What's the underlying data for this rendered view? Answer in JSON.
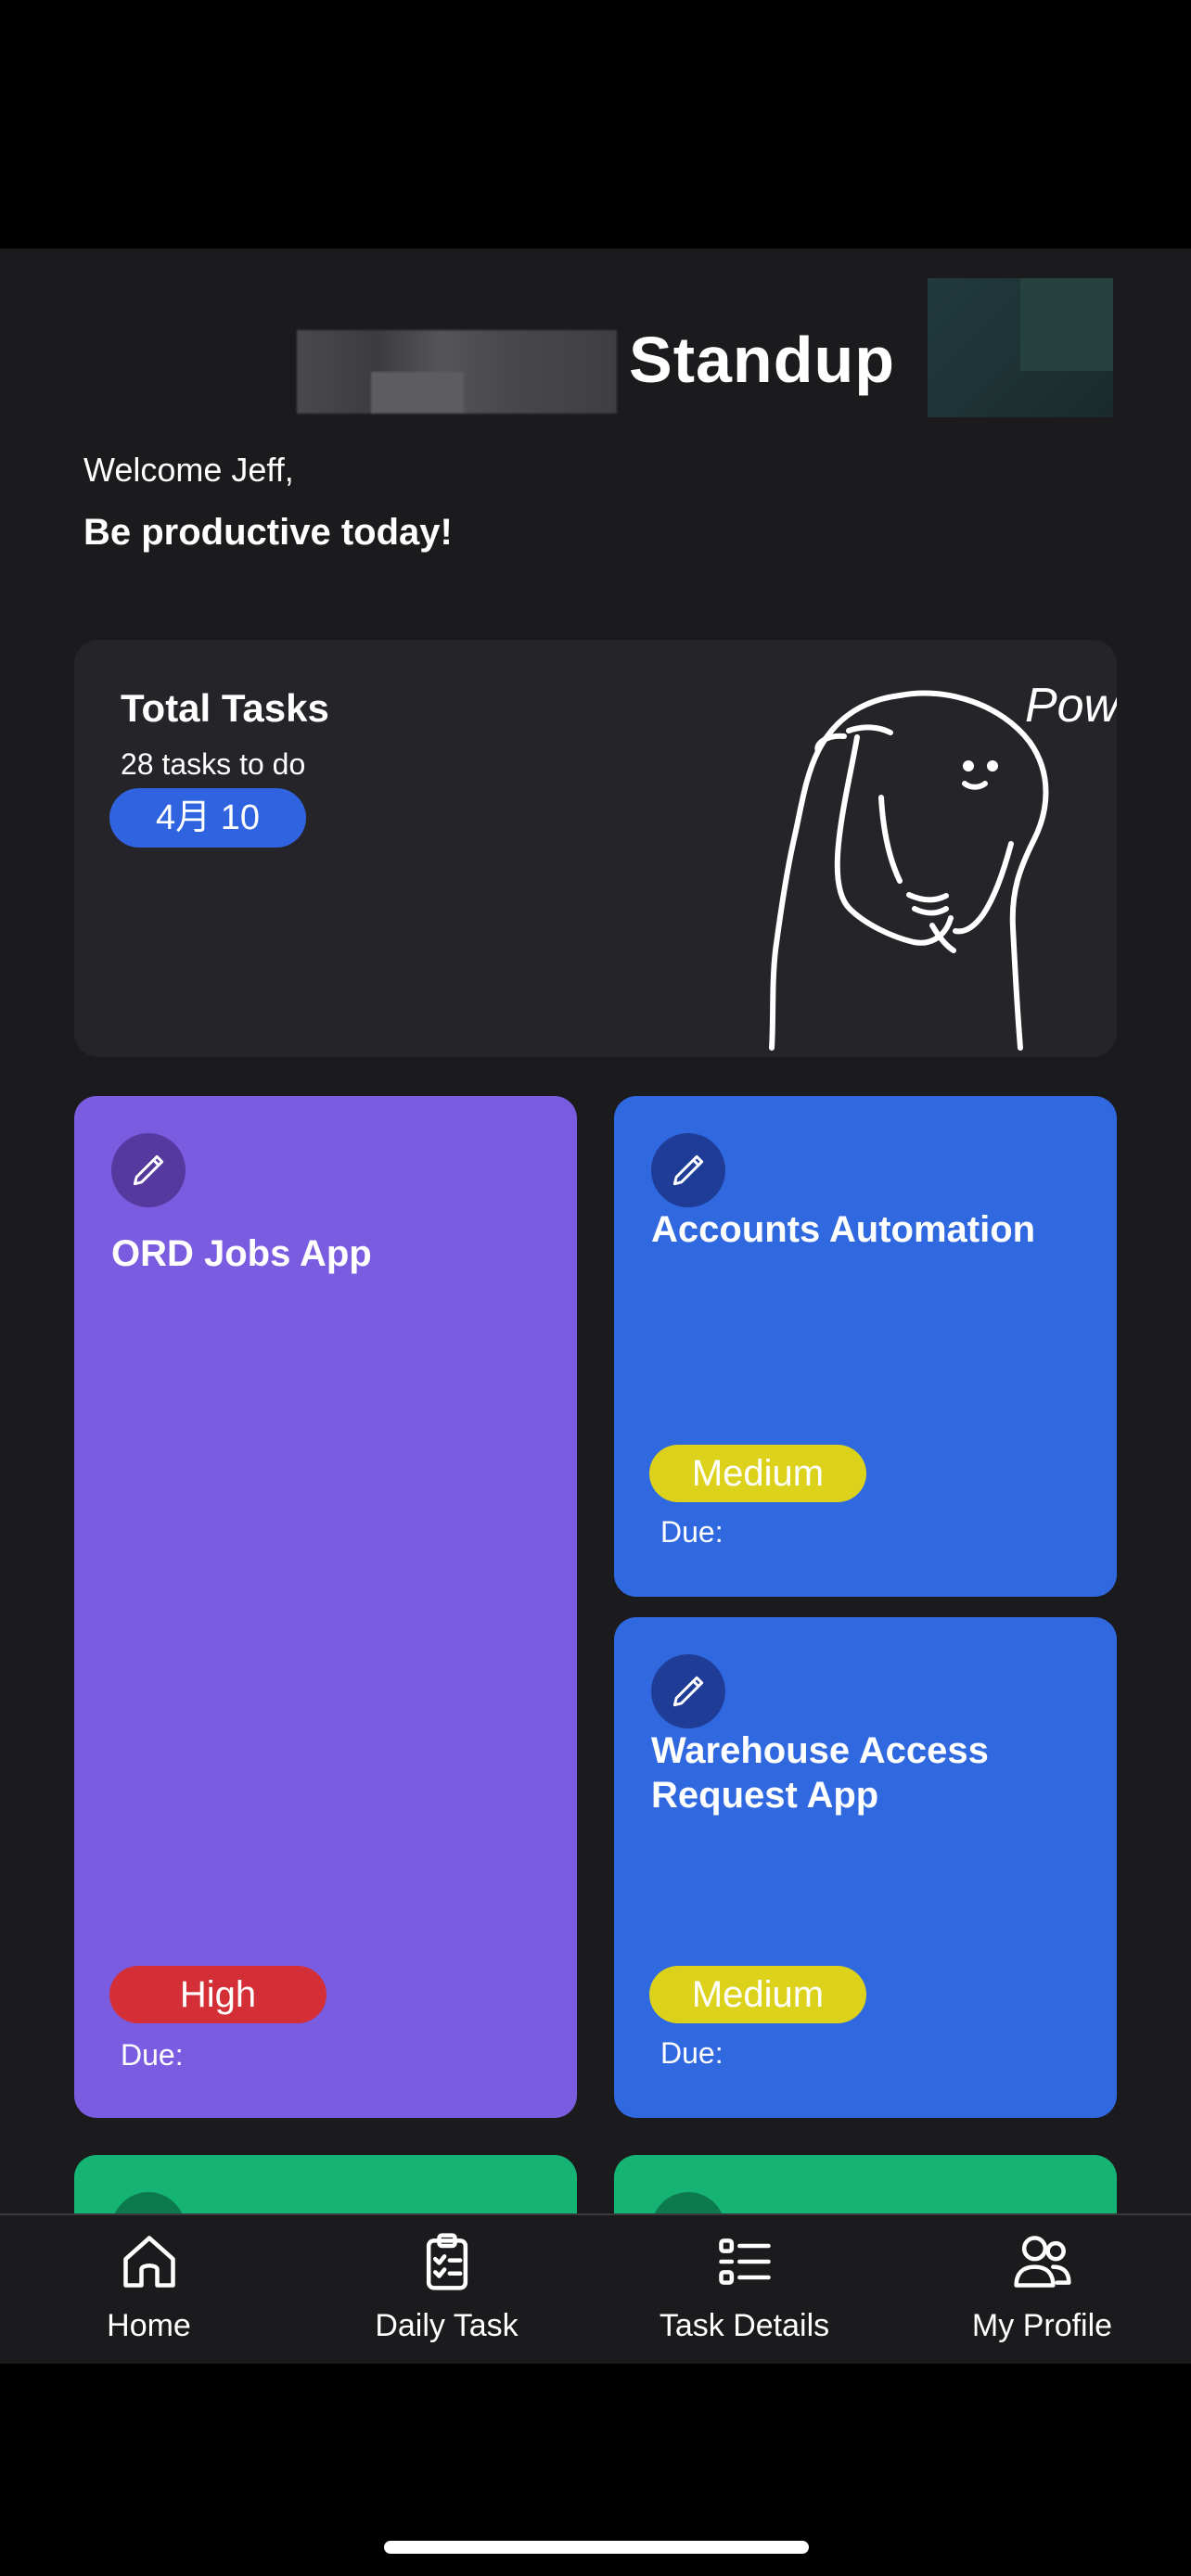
{
  "header": {
    "title": "Standup"
  },
  "greeting": {
    "welcome": "Welcome Jeff,",
    "tagline": "Be productive today!"
  },
  "summary": {
    "title": "Total Tasks",
    "subtitle": "28 tasks to do",
    "date": "4月 10",
    "doodle_text": "Power"
  },
  "tasks": [
    {
      "title": "ORD Jobs App",
      "priority": "High",
      "due_label": "Due:",
      "color": "#7a5ce0",
      "icon": "pencil-icon"
    },
    {
      "title": "Accounts Automation",
      "priority": "Medium",
      "due_label": "Due:",
      "color": "#3068e0",
      "icon": "pencil-icon"
    },
    {
      "title": "Warehouse Access Request App",
      "priority": "Medium",
      "due_label": "Due:",
      "color": "#3068e0",
      "icon": "pencil-icon"
    },
    {
      "color": "#15b374",
      "icon": "pencil-icon"
    },
    {
      "color": "#15b374",
      "icon": "pencil-icon"
    }
  ],
  "colors": {
    "background": "#1b1b1d",
    "card": "#252529",
    "accent_blue": "#2f63df",
    "priority_high": "#d42f36",
    "priority_medium": "#dcd21c"
  },
  "nav": [
    {
      "label": "Home",
      "icon": "home-icon"
    },
    {
      "label": "Daily Task",
      "icon": "clipboard-check-icon"
    },
    {
      "label": "Task Details",
      "icon": "list-icon"
    },
    {
      "label": "My Profile",
      "icon": "users-icon"
    }
  ]
}
